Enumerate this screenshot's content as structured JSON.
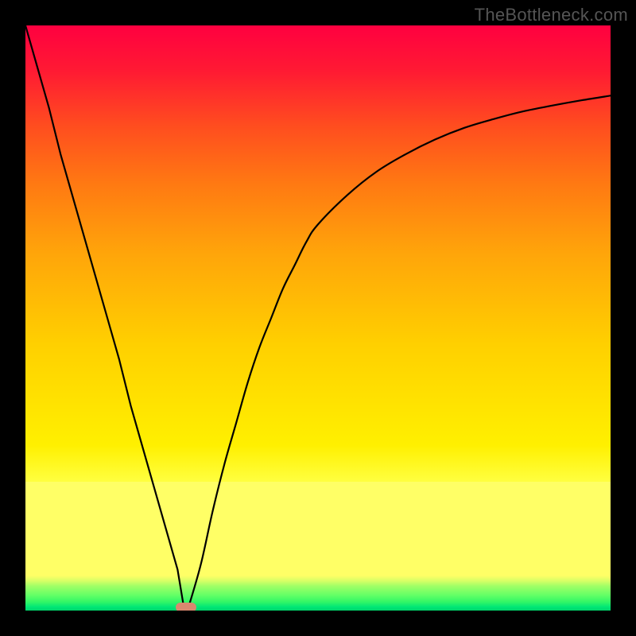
{
  "watermark": "TheBottleneck.com",
  "colors": {
    "frame": "#000000",
    "curve": "#000000",
    "marker": "#d9886f",
    "gradient_top": "#ff0040",
    "gradient_mid": "#ffd000",
    "gradient_yellow": "#ffff66",
    "gradient_green": "#00d66a"
  },
  "chart_data": {
    "type": "line",
    "title": "",
    "xlabel": "",
    "ylabel": "",
    "xlim": [
      0,
      100
    ],
    "ylim": [
      0,
      100
    ],
    "x": [
      0,
      2,
      4,
      6,
      8,
      10,
      12,
      14,
      16,
      18,
      20,
      22,
      24,
      26,
      27,
      28,
      30,
      32,
      34,
      36,
      38,
      40,
      42,
      44,
      46,
      48,
      50,
      55,
      60,
      65,
      70,
      75,
      80,
      85,
      90,
      95,
      100
    ],
    "y": [
      100,
      93,
      86,
      78,
      71,
      64,
      57,
      50,
      43,
      35,
      28,
      21,
      14,
      7,
      1,
      1,
      8,
      17,
      25,
      32,
      39,
      45,
      50,
      55,
      59,
      63,
      66,
      71,
      75,
      78,
      80.5,
      82.5,
      84,
      85.3,
      86.3,
      87.2,
      88
    ],
    "series": [
      {
        "name": "bottleneck-curve",
        "x": [
          0,
          2,
          4,
          6,
          8,
          10,
          12,
          14,
          16,
          18,
          20,
          22,
          24,
          26,
          27,
          28,
          30,
          32,
          34,
          36,
          38,
          40,
          42,
          44,
          46,
          48,
          50,
          55,
          60,
          65,
          70,
          75,
          80,
          85,
          90,
          95,
          100
        ],
        "y": [
          100,
          93,
          86,
          78,
          71,
          64,
          57,
          50,
          43,
          35,
          28,
          21,
          14,
          7,
          1,
          1,
          8,
          17,
          25,
          32,
          39,
          45,
          50,
          55,
          59,
          63,
          66,
          71,
          75,
          78,
          80.5,
          82.5,
          84,
          85.3,
          86.3,
          87.2,
          88
        ]
      }
    ],
    "marker": {
      "x": 27.5,
      "y": 0.5
    },
    "legend": false,
    "grid": false
  }
}
